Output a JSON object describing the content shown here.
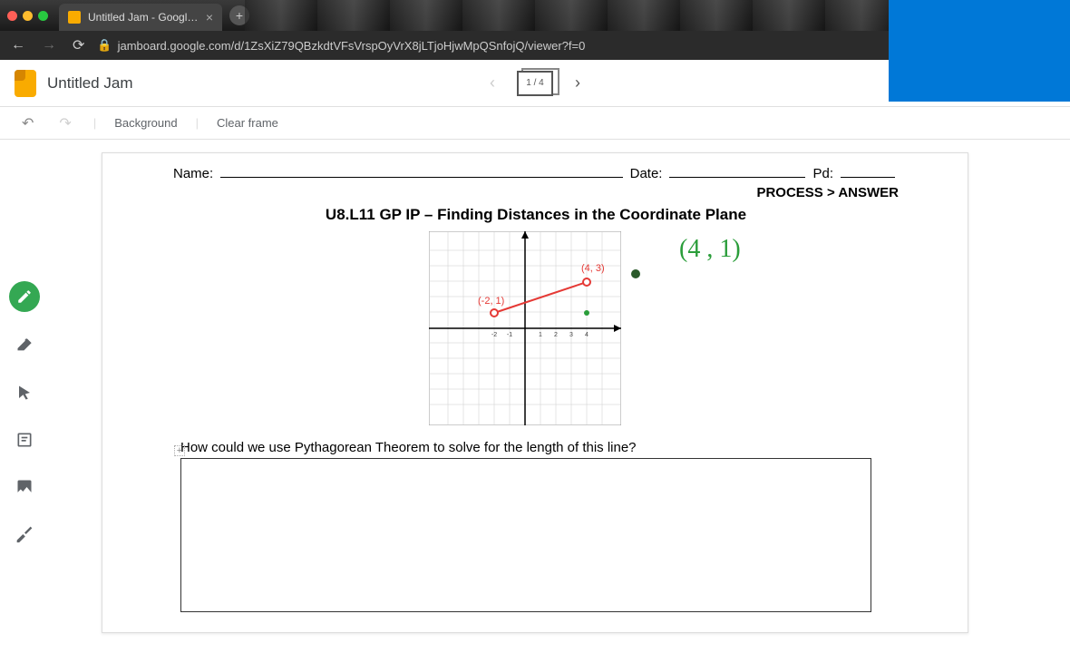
{
  "browser": {
    "tab_title": "Untitled Jam - Google Jamboa",
    "url": "jamboard.google.com/d/1ZsXiZ79QBzkdtVFsVrspOyVrX8jLTjoHjwMpQSnfojQ/viewer?f=0"
  },
  "app": {
    "doc_title": "Untitled Jam",
    "frame_label": "1 / 4",
    "background_label": "Background",
    "clear_frame_label": "Clear frame"
  },
  "worksheet": {
    "name_label": "Name:",
    "date_label": "Date:",
    "pd_label": "Pd:",
    "header": "PROCESS > ANSWER",
    "title": "U8.L11 GP IP – Finding Distances in the Coordinate Plane",
    "point_a": "(-2, 1)",
    "point_b": "(4, 3)",
    "question": "How could we use Pythagorean Theorem to solve for the length of this line?",
    "handwritten": "(4 , 1)"
  }
}
